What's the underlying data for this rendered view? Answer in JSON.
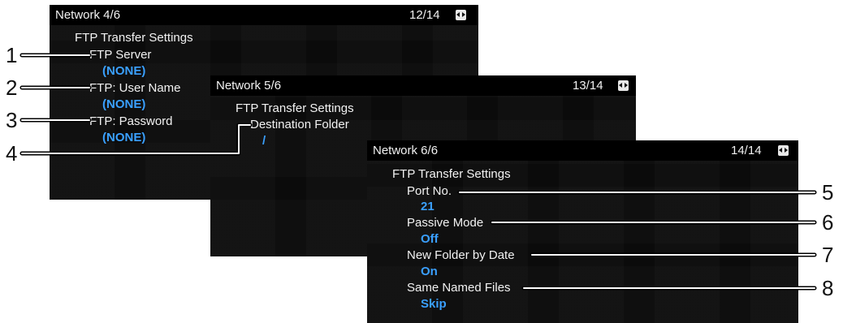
{
  "screens": [
    {
      "title": "Network 4/6",
      "page": "12/14",
      "section": "FTP Transfer Settings",
      "items": [
        {
          "label": "FTP Server",
          "value": "(NONE)"
        },
        {
          "label": "FTP: User Name",
          "value": "(NONE)"
        },
        {
          "label": "FTP: Password",
          "value": "(NONE)"
        }
      ]
    },
    {
      "title": "Network 5/6",
      "page": "13/14",
      "section": "FTP Transfer Settings",
      "items": [
        {
          "label": "Destination Folder",
          "value": "/"
        }
      ]
    },
    {
      "title": "Network 6/6",
      "page": "14/14",
      "section": "FTP Transfer Settings",
      "items": [
        {
          "label": "Port No.",
          "value": "21"
        },
        {
          "label": "Passive Mode",
          "value": "Off"
        },
        {
          "label": "New Folder by Date",
          "value": "On"
        },
        {
          "label": "Same Named Files",
          "value": "Skip"
        }
      ]
    }
  ],
  "callouts": [
    "1",
    "2",
    "3",
    "4",
    "5",
    "6",
    "7",
    "8"
  ],
  "colors": {
    "value": "#3aa0ff",
    "text": "#f2f2f2",
    "background": "#0b0b0b"
  },
  "icons": {
    "page_switch": "left-right-arrows-icon"
  }
}
